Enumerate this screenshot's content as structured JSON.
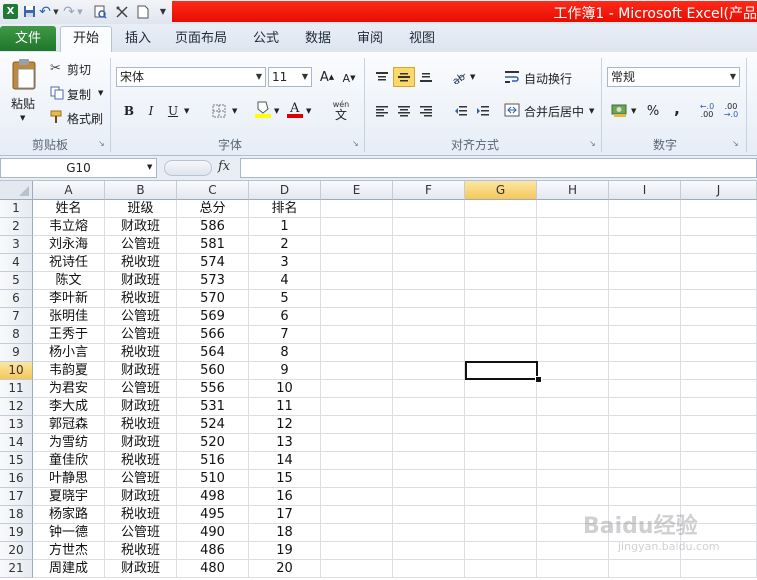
{
  "window": {
    "title": "工作簿1 - Microsoft Excel(产品"
  },
  "qat": {
    "save": "💾",
    "undo": "↶",
    "redo": "↷"
  },
  "tabs": [
    "文件",
    "开始",
    "插入",
    "页面布局",
    "公式",
    "数据",
    "审阅",
    "视图"
  ],
  "ribbon": {
    "clipboard": {
      "paste": "粘贴",
      "cut": "剪切",
      "copy": "复制",
      "format_painter": "格式刷",
      "label": "剪贴板"
    },
    "font": {
      "name": "宋体",
      "size": "11",
      "grow": "A",
      "shrink": "A",
      "bold": "B",
      "italic": "I",
      "underline": "U",
      "phonetic": "wén",
      "label": "字体"
    },
    "alignment": {
      "wrap": "自动换行",
      "merge": "合并后居中",
      "label": "对齐方式"
    },
    "number": {
      "format": "常规",
      "percent": "%",
      "comma": ",",
      "label": "数字"
    }
  },
  "formula_bar": {
    "name_box": "G10",
    "fx": "fx",
    "value": ""
  },
  "columns": [
    "A",
    "B",
    "C",
    "D",
    "E",
    "F",
    "G",
    "H",
    "I",
    "J"
  ],
  "selected": {
    "column": "G",
    "row": "10"
  },
  "rows": [
    {
      "n": "1",
      "a": "姓名",
      "b": "班级",
      "c": "总分",
      "d": "排名"
    },
    {
      "n": "2",
      "a": "韦立熔",
      "b": "财政班",
      "c": "586",
      "d": "1"
    },
    {
      "n": "3",
      "a": "刘永海",
      "b": "公管班",
      "c": "581",
      "d": "2"
    },
    {
      "n": "4",
      "a": "祝诗任",
      "b": "税收班",
      "c": "574",
      "d": "3"
    },
    {
      "n": "5",
      "a": "陈文",
      "b": "财政班",
      "c": "573",
      "d": "4"
    },
    {
      "n": "6",
      "a": "李叶新",
      "b": "税收班",
      "c": "570",
      "d": "5"
    },
    {
      "n": "7",
      "a": "张明佳",
      "b": "公管班",
      "c": "569",
      "d": "6"
    },
    {
      "n": "8",
      "a": "王秀于",
      "b": "公管班",
      "c": "566",
      "d": "7"
    },
    {
      "n": "9",
      "a": "杨小言",
      "b": "税收班",
      "c": "564",
      "d": "8"
    },
    {
      "n": "10",
      "a": "韦韵夏",
      "b": "财政班",
      "c": "560",
      "d": "9"
    },
    {
      "n": "11",
      "a": "为君安",
      "b": "公管班",
      "c": "556",
      "d": "10"
    },
    {
      "n": "12",
      "a": "李大成",
      "b": "财政班",
      "c": "531",
      "d": "11"
    },
    {
      "n": "13",
      "a": "郭冠森",
      "b": "税收班",
      "c": "524",
      "d": "12"
    },
    {
      "n": "14",
      "a": "为雪纺",
      "b": "财政班",
      "c": "520",
      "d": "13"
    },
    {
      "n": "15",
      "a": "童佳欣",
      "b": "税收班",
      "c": "516",
      "d": "14"
    },
    {
      "n": "16",
      "a": "叶静思",
      "b": "公管班",
      "c": "510",
      "d": "15"
    },
    {
      "n": "17",
      "a": "夏晓宇",
      "b": "财政班",
      "c": "498",
      "d": "16"
    },
    {
      "n": "18",
      "a": "杨家路",
      "b": "税收班",
      "c": "495",
      "d": "17"
    },
    {
      "n": "19",
      "a": "钟一德",
      "b": "公管班",
      "c": "490",
      "d": "18"
    },
    {
      "n": "20",
      "a": "方世杰",
      "b": "税收班",
      "c": "486",
      "d": "19"
    },
    {
      "n": "21",
      "a": "周建成",
      "b": "财政班",
      "c": "480",
      "d": "20"
    }
  ],
  "watermark": {
    "brand": "Baidu经验",
    "url": "jingyan.baidu.com"
  },
  "colors": {
    "title_red": "#e50d00",
    "file_tab": "#20762a",
    "selection": "#f5c75a"
  }
}
